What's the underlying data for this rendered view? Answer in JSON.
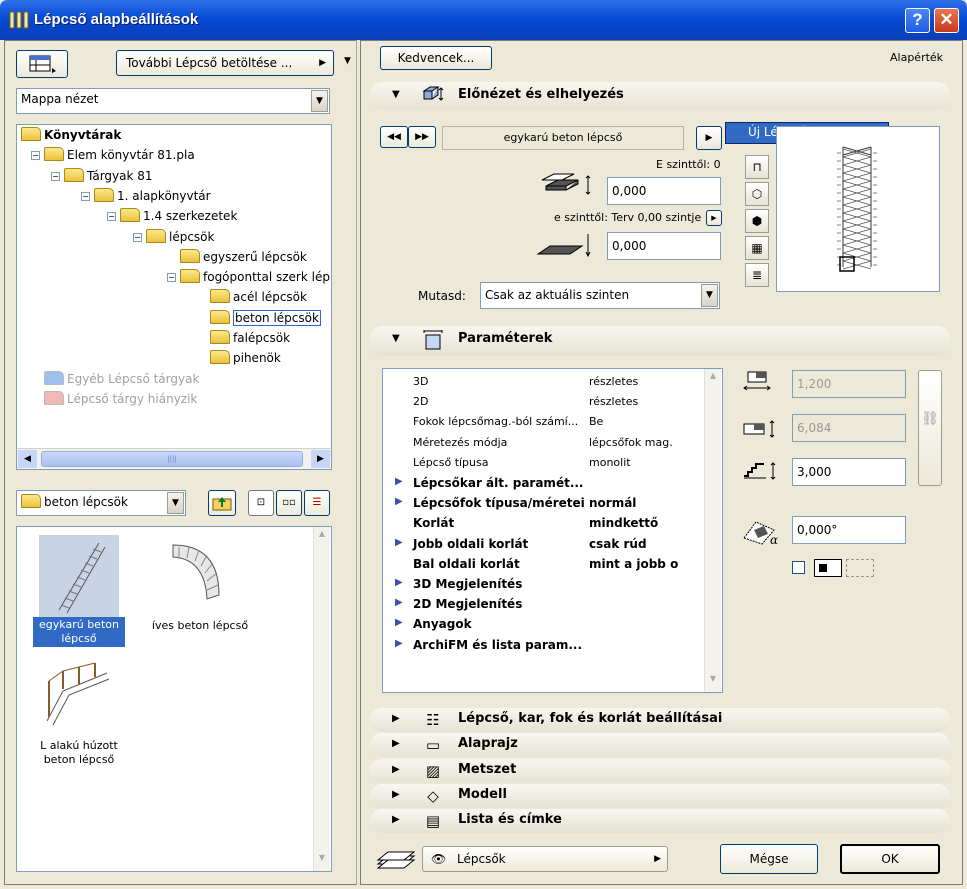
{
  "window": {
    "title": "Lépcső alapbeállítások",
    "help_label": "?",
    "close_label": "✕"
  },
  "left": {
    "load_more_label": "További Lépcső betöltése ...",
    "view_select": "Mappa nézet",
    "tree": [
      {
        "label": "Könyvtárak",
        "indent": 0,
        "bold": true,
        "dim": false
      },
      {
        "label": "Elem könyvtár 81.pla",
        "indent": 1,
        "dim": false
      },
      {
        "label": "Tárgyak 81",
        "indent": 2,
        "dim": false
      },
      {
        "label": "1. alapkönyvtár",
        "indent": 3,
        "dim": false
      },
      {
        "label": "1.4 szerkezetek",
        "indent": 4,
        "dim": false
      },
      {
        "label": "lépcsök",
        "indent": 5,
        "dim": false
      },
      {
        "label": "egyszerű lépcsök",
        "indent": 6,
        "dim": false
      },
      {
        "label": "fogóponttal szerk lép",
        "indent": 6,
        "dim": false
      },
      {
        "label": "acél lépcsök",
        "indent": 7,
        "dim": false
      },
      {
        "label": "beton lépcsök",
        "indent": 7,
        "dim": false,
        "selected": true
      },
      {
        "label": "falépcsök",
        "indent": 7,
        "dim": false
      },
      {
        "label": "pihenök",
        "indent": 7,
        "dim": false
      },
      {
        "label": "Egyéb Lépcső tárgyak",
        "indent": 1,
        "dim": true
      },
      {
        "label": "Lépcső tárgy hiányzik",
        "indent": 1,
        "dim": true
      }
    ],
    "folder_select": "beton lépcsök",
    "thumbnails": [
      {
        "label": "egykarú beton lépcső",
        "selected": true
      },
      {
        "label": "íves beton lépcső",
        "selected": false
      },
      {
        "label": "L alakú húzott beton lépcső",
        "selected": false
      }
    ]
  },
  "right": {
    "favorites_label": "Kedvencek...",
    "defaults_label": "Alapérték",
    "sec_preview": "Előnézet és elhelyezés",
    "object_name": "egykarú beton lépcső",
    "new_stair_menu": "Új Lépcső...",
    "from_story_label": "E szinttől: 0",
    "from_story_value": "0,000",
    "to_story_label": "e szinttől: Terv 0,00 szintje",
    "to_story_value": "0,000",
    "show_label": "Mutasd:",
    "show_select": "Csak az aktuális szinten",
    "sec_params": "Paraméterek",
    "params": [
      {
        "name": "3D",
        "value": "részletes",
        "bold": false,
        "tri": false
      },
      {
        "name": "2D",
        "value": "részletes",
        "bold": false,
        "tri": false
      },
      {
        "name": "Fokok lépcsőmag.-ból számí...",
        "value": "Be",
        "bold": false,
        "tri": false
      },
      {
        "name": "Méretezés módja",
        "value": "lépcsőfok mag.",
        "bold": false,
        "tri": false
      },
      {
        "name": "Lépcső típusa",
        "value": "monolit",
        "bold": false,
        "tri": false
      },
      {
        "name": "Lépcsőkar ált. paramét...",
        "value": "",
        "bold": true,
        "tri": true
      },
      {
        "name": "Lépcsőfok típusa/méretei",
        "value": "normál",
        "bold": true,
        "tri": true
      },
      {
        "name": "Korlát",
        "value": "mindkettő",
        "bold": true,
        "tri": false
      },
      {
        "name": "Jobb oldali korlát",
        "value": "csak rúd",
        "bold": true,
        "tri": true
      },
      {
        "name": "Bal oldali korlát",
        "value": "mint a jobb o",
        "bold": true,
        "tri": false
      },
      {
        "name": "3D Megjelenítés",
        "value": "",
        "bold": true,
        "tri": true
      },
      {
        "name": "2D Megjelenítés",
        "value": "",
        "bold": true,
        "tri": true
      },
      {
        "name": "Anyagok",
        "value": "",
        "bold": true,
        "tri": true
      },
      {
        "name": "ArchiFM és lista param...",
        "value": "",
        "bold": true,
        "tri": true
      }
    ],
    "dim_width": "1,200",
    "dim_length": "6,084",
    "dim_height": "3,000",
    "angle": "0,000°",
    "sections": [
      {
        "label": "Lépcső, kar, fok és korlát beállításai"
      },
      {
        "label": "Alaprajz"
      },
      {
        "label": "Metszet"
      },
      {
        "label": "Modell"
      },
      {
        "label": "Lista és címke"
      }
    ],
    "layer_select": "Lépcsők",
    "cancel_label": "Mégse",
    "ok_label": "OK"
  }
}
